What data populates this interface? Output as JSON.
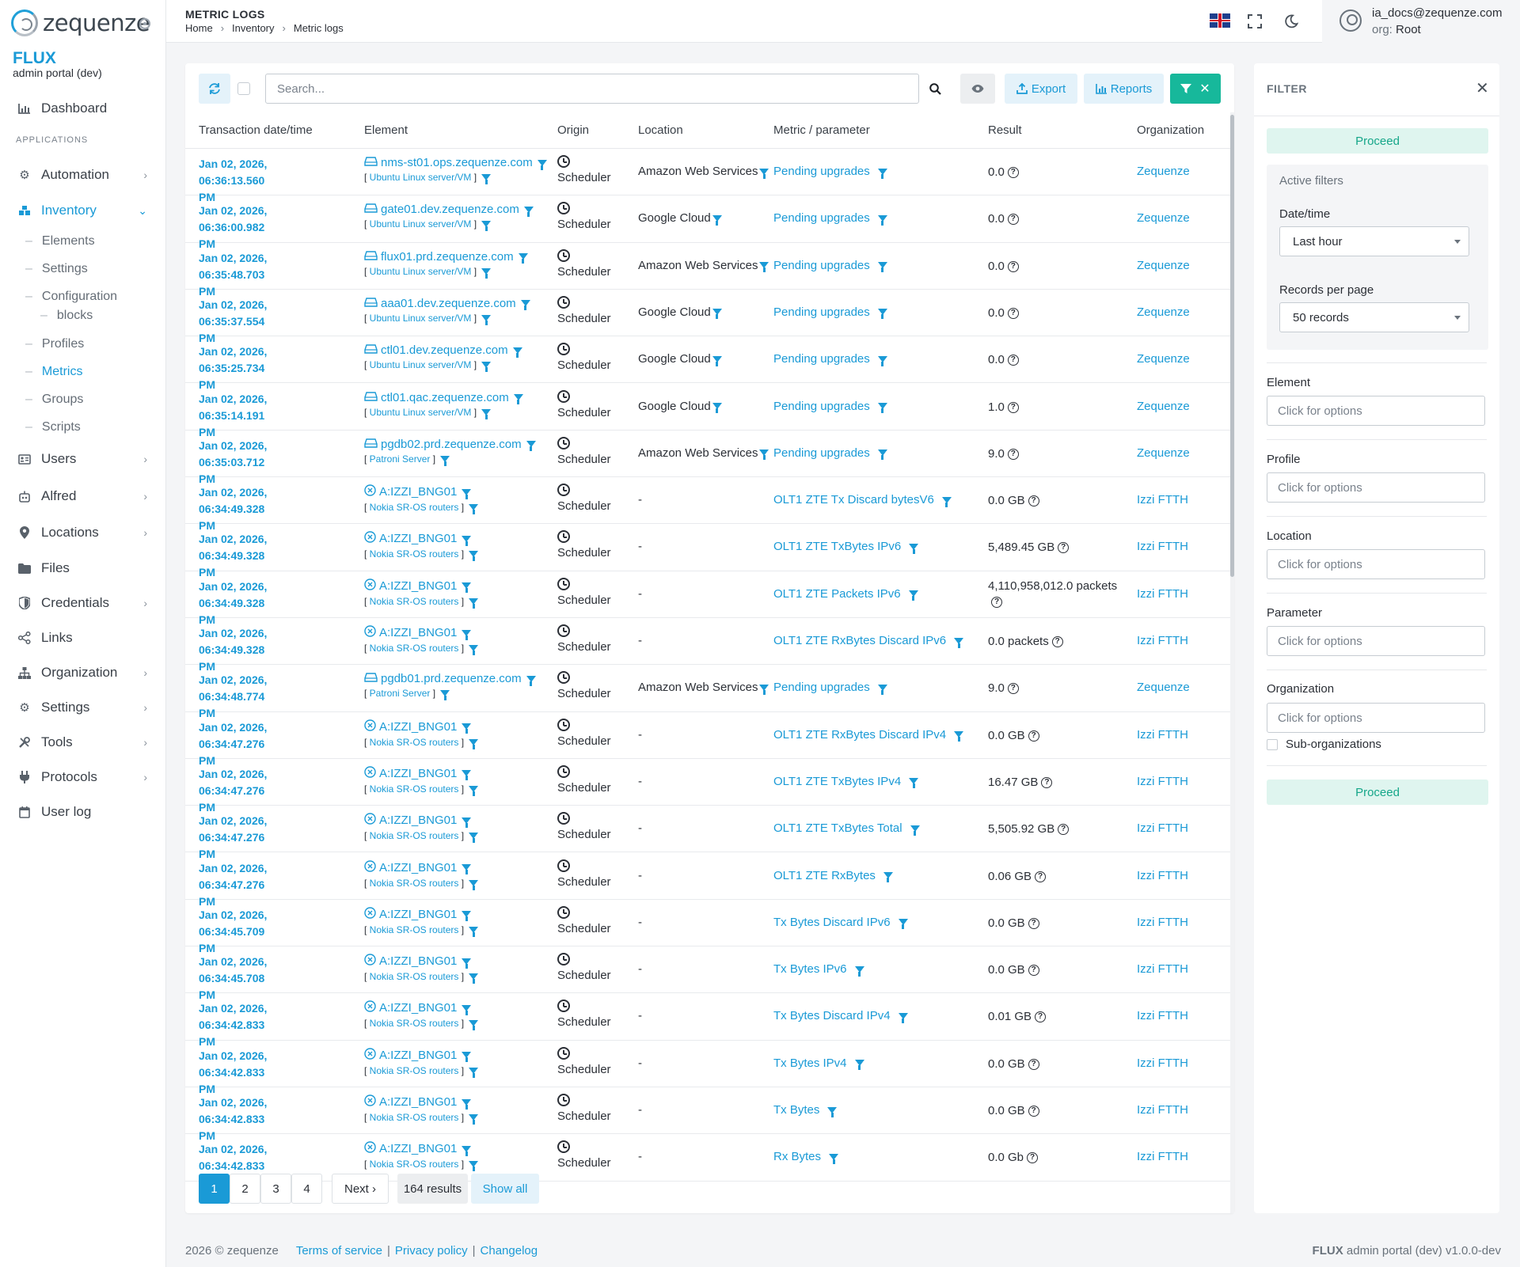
{
  "brand": {
    "logo": "zequenze",
    "product": "FLUX",
    "portal": "admin portal (dev)"
  },
  "sidebar": {
    "dashboard": "Dashboard",
    "section_applications": "APPLICATIONS",
    "automation": "Automation",
    "inventory": "Inventory",
    "inventory_sub": [
      "Elements",
      "Settings",
      "Configuration",
      "blocks",
      "Profiles",
      "Metrics",
      "Groups",
      "Scripts"
    ],
    "users": "Users",
    "alfred": "Alfred",
    "locations": "Locations",
    "files": "Files",
    "credentials": "Credentials",
    "links": "Links",
    "organization": "Organization",
    "settings": "Settings",
    "tools": "Tools",
    "protocols": "Protocols",
    "user_log": "User log"
  },
  "header": {
    "title": "METRIC LOGS",
    "breadcrumb": [
      "Home",
      "Inventory",
      "Metric logs"
    ],
    "user_email": "ia_docs@zequenze.com",
    "org_label": "org:",
    "org_value": "Root"
  },
  "toolbar": {
    "search_placeholder": "Search...",
    "export": "Export",
    "reports": "Reports"
  },
  "table": {
    "columns": [
      "Transaction date/time",
      "Element",
      "Origin",
      "Location",
      "Metric / parameter",
      "Result",
      "Organization"
    ],
    "rows": [
      {
        "date": "Jan 02, 2026, 06:36:13.560",
        "pm": "PM",
        "element": "nms-st01.ops.zequenze.com",
        "profile": "Ubuntu Linux server/VM",
        "type": "server",
        "origin": "Scheduler",
        "location": "Amazon Web Services",
        "metric": "Pending upgrades",
        "result": "0.0",
        "org": "Zequenze"
      },
      {
        "date": "Jan 02, 2026, 06:36:00.982",
        "pm": "PM",
        "element": "gate01.dev.zequenze.com",
        "profile": "Ubuntu Linux server/VM",
        "type": "server",
        "origin": "Scheduler",
        "location": "Google Cloud",
        "metric": "Pending upgrades",
        "result": "0.0",
        "org": "Zequenze"
      },
      {
        "date": "Jan 02, 2026, 06:35:48.703",
        "pm": "PM",
        "element": "flux01.prd.zequenze.com",
        "profile": "Ubuntu Linux server/VM",
        "type": "server",
        "origin": "Scheduler",
        "location": "Amazon Web Services",
        "metric": "Pending upgrades",
        "result": "0.0",
        "org": "Zequenze"
      },
      {
        "date": "Jan 02, 2026, 06:35:37.554",
        "pm": "PM",
        "element": "aaa01.dev.zequenze.com",
        "profile": "Ubuntu Linux server/VM",
        "type": "server",
        "origin": "Scheduler",
        "location": "Google Cloud",
        "metric": "Pending upgrades",
        "result": "0.0",
        "org": "Zequenze"
      },
      {
        "date": "Jan 02, 2026, 06:35:25.734",
        "pm": "PM",
        "element": "ctl01.dev.zequenze.com",
        "profile": "Ubuntu Linux server/VM",
        "type": "server",
        "origin": "Scheduler",
        "location": "Google Cloud",
        "metric": "Pending upgrades",
        "result": "0.0",
        "org": "Zequenze"
      },
      {
        "date": "Jan 02, 2026, 06:35:14.191",
        "pm": "PM",
        "element": "ctl01.qac.zequenze.com",
        "profile": "Ubuntu Linux server/VM",
        "type": "server",
        "origin": "Scheduler",
        "location": "Google Cloud",
        "metric": "Pending upgrades",
        "result": "1.0",
        "org": "Zequenze"
      },
      {
        "date": "Jan 02, 2026, 06:35:03.712",
        "pm": "PM",
        "element": "pgdb02.prd.zequenze.com",
        "profile": "Patroni Server",
        "type": "server",
        "origin": "Scheduler",
        "location": "Amazon Web Services",
        "metric": "Pending upgrades",
        "result": "9.0",
        "org": "Zequenze"
      },
      {
        "date": "Jan 02, 2026, 06:34:49.328",
        "pm": "PM",
        "element": "A:IZZI_BNG01",
        "profile": "Nokia SR-OS routers",
        "type": "router",
        "origin": "Scheduler",
        "location": "-",
        "metric": "OLT1 ZTE Tx Discard bytesV6",
        "result": "0.0 GB",
        "org": "Izzi FTTH"
      },
      {
        "date": "Jan 02, 2026, 06:34:49.328",
        "pm": "PM",
        "element": "A:IZZI_BNG01",
        "profile": "Nokia SR-OS routers",
        "type": "router",
        "origin": "Scheduler",
        "location": "-",
        "metric": "OLT1 ZTE TxBytes IPv6",
        "result": "5,489.45 GB",
        "org": "Izzi FTTH"
      },
      {
        "date": "Jan 02, 2026, 06:34:49.328",
        "pm": "PM",
        "element": "A:IZZI_BNG01",
        "profile": "Nokia SR-OS routers",
        "type": "router",
        "origin": "Scheduler",
        "location": "-",
        "metric": "OLT1 ZTE Packets IPv6",
        "result": "4,110,958,012.0 packets",
        "org": "Izzi FTTH"
      },
      {
        "date": "Jan 02, 2026, 06:34:49.328",
        "pm": "PM",
        "element": "A:IZZI_BNG01",
        "profile": "Nokia SR-OS routers",
        "type": "router",
        "origin": "Scheduler",
        "location": "-",
        "metric": "OLT1 ZTE RxBytes Discard IPv6",
        "result": "0.0 packets",
        "org": "Izzi FTTH"
      },
      {
        "date": "Jan 02, 2026, 06:34:48.774",
        "pm": "PM",
        "element": "pgdb01.prd.zequenze.com",
        "profile": "Patroni Server",
        "type": "server",
        "origin": "Scheduler",
        "location": "Amazon Web Services",
        "metric": "Pending upgrades",
        "result": "9.0",
        "org": "Zequenze"
      },
      {
        "date": "Jan 02, 2026, 06:34:47.276",
        "pm": "PM",
        "element": "A:IZZI_BNG01",
        "profile": "Nokia SR-OS routers",
        "type": "router",
        "origin": "Scheduler",
        "location": "-",
        "metric": "OLT1 ZTE RxBytes Discard IPv4",
        "result": "0.0 GB",
        "org": "Izzi FTTH"
      },
      {
        "date": "Jan 02, 2026, 06:34:47.276",
        "pm": "PM",
        "element": "A:IZZI_BNG01",
        "profile": "Nokia SR-OS routers",
        "type": "router",
        "origin": "Scheduler",
        "location": "-",
        "metric": "OLT1 ZTE TxBytes IPv4",
        "result": "16.47 GB",
        "org": "Izzi FTTH"
      },
      {
        "date": "Jan 02, 2026, 06:34:47.276",
        "pm": "PM",
        "element": "A:IZZI_BNG01",
        "profile": "Nokia SR-OS routers",
        "type": "router",
        "origin": "Scheduler",
        "location": "-",
        "metric": "OLT1 ZTE TxBytes Total",
        "result": "5,505.92 GB",
        "org": "Izzi FTTH"
      },
      {
        "date": "Jan 02, 2026, 06:34:47.276",
        "pm": "PM",
        "element": "A:IZZI_BNG01",
        "profile": "Nokia SR-OS routers",
        "type": "router",
        "origin": "Scheduler",
        "location": "-",
        "metric": "OLT1 ZTE RxBytes",
        "result": "0.06 GB",
        "org": "Izzi FTTH"
      },
      {
        "date": "Jan 02, 2026, 06:34:45.709",
        "pm": "PM",
        "element": "A:IZZI_BNG01",
        "profile": "Nokia SR-OS routers",
        "type": "router",
        "origin": "Scheduler",
        "location": "-",
        "metric": "Tx Bytes Discard IPv6",
        "result": "0.0 GB",
        "org": "Izzi FTTH"
      },
      {
        "date": "Jan 02, 2026, 06:34:45.708",
        "pm": "PM",
        "element": "A:IZZI_BNG01",
        "profile": "Nokia SR-OS routers",
        "type": "router",
        "origin": "Scheduler",
        "location": "-",
        "metric": "Tx Bytes IPv6",
        "result": "0.0 GB",
        "org": "Izzi FTTH"
      },
      {
        "date": "Jan 02, 2026, 06:34:42.833",
        "pm": "PM",
        "element": "A:IZZI_BNG01",
        "profile": "Nokia SR-OS routers",
        "type": "router",
        "origin": "Scheduler",
        "location": "-",
        "metric": "Tx Bytes Discard IPv4",
        "result": "0.01 GB",
        "org": "Izzi FTTH"
      },
      {
        "date": "Jan 02, 2026, 06:34:42.833",
        "pm": "PM",
        "element": "A:IZZI_BNG01",
        "profile": "Nokia SR-OS routers",
        "type": "router",
        "origin": "Scheduler",
        "location": "-",
        "metric": "Tx Bytes IPv4",
        "result": "0.0 GB",
        "org": "Izzi FTTH"
      },
      {
        "date": "Jan 02, 2026, 06:34:42.833",
        "pm": "PM",
        "element": "A:IZZI_BNG01",
        "profile": "Nokia SR-OS routers",
        "type": "router",
        "origin": "Scheduler",
        "location": "-",
        "metric": "Tx Bytes",
        "result": "0.0 GB",
        "org": "Izzi FTTH"
      },
      {
        "date": "Jan 02, 2026, 06:34:42.833",
        "pm": "PM",
        "element": "A:IZZI_BNG01",
        "profile": "Nokia SR-OS routers",
        "type": "router",
        "origin": "Scheduler",
        "location": "-",
        "metric": "Rx Bytes",
        "result": "0.0 Gb",
        "org": "Izzi FTTH"
      }
    ]
  },
  "pagination": {
    "pages": [
      "1",
      "2",
      "3",
      "4"
    ],
    "current": "1",
    "next": "Next ›",
    "results": "164 results",
    "show_all": "Show all"
  },
  "filter": {
    "title": "FILTER",
    "proceed": "Proceed",
    "active_filters": "Active filters",
    "datetime_label": "Date/time",
    "datetime_value": "Last hour",
    "records_label": "Records per page",
    "records_value": "50 records",
    "element_label": "Element",
    "profile_label": "Profile",
    "location_label": "Location",
    "parameter_label": "Parameter",
    "organization_label": "Organization",
    "placeholder": "Click for options",
    "sub_orgs": "Sub-organizations"
  },
  "footer": {
    "copyright": "2026 © zequenze",
    "links": [
      "Terms of service",
      "Privacy policy",
      "Changelog"
    ],
    "version_brand": "FLUX",
    "version_text": "admin portal (dev) v1.0.0-dev"
  },
  "colors": {
    "accent": "#1a9ad6",
    "green": "#17b89b",
    "proceed_bg": "#dff5ef"
  }
}
